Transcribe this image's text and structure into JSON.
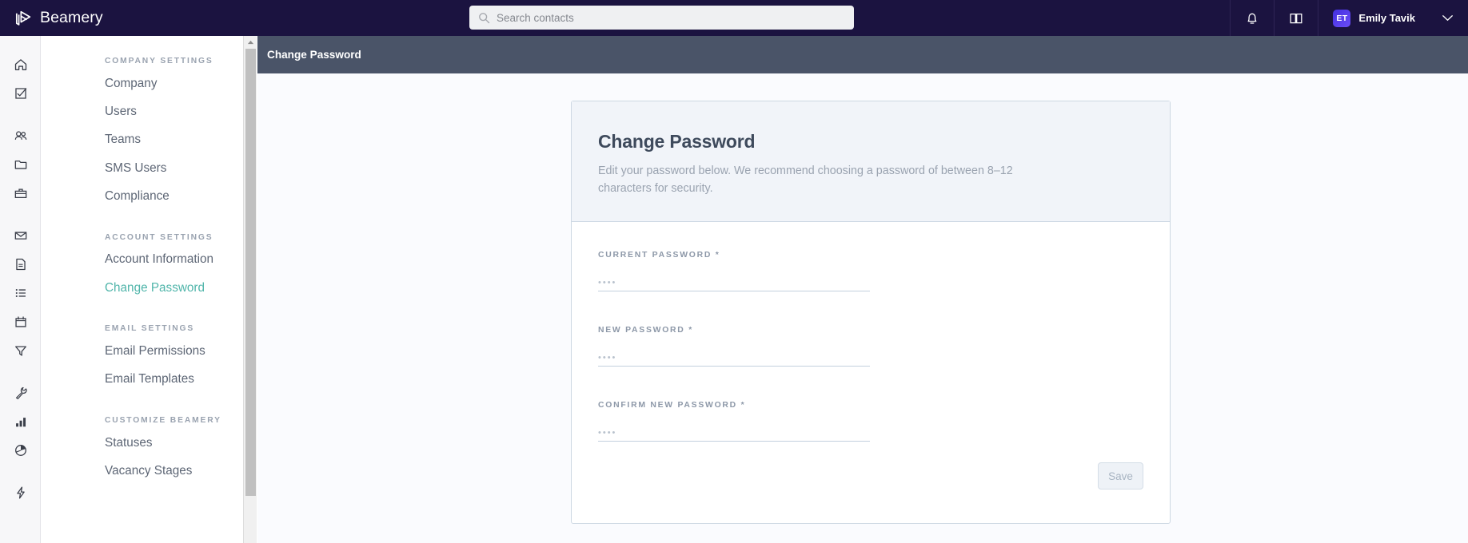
{
  "brand": {
    "name": "Beamery",
    "logo_icon": "beamery-cube-icon"
  },
  "search": {
    "placeholder": "Search contacts",
    "value": "",
    "icon": "search-icon"
  },
  "topbar": {
    "notifications_icon": "bell-icon",
    "knowledge_icon": "book-icon",
    "user_initials": "ET",
    "user_name": "Emily Tavik",
    "caret_icon": "chevron-down-icon",
    "background": "#1b1340"
  },
  "rail": {
    "items": [
      {
        "icon": "home-icon",
        "name": "home"
      },
      {
        "icon": "task-check-icon",
        "name": "tasks"
      },
      {
        "icon": "people-icon",
        "name": "contacts"
      },
      {
        "icon": "folder-icon",
        "name": "pools"
      },
      {
        "icon": "briefcase-icon",
        "name": "vacancies"
      },
      {
        "icon": "envelope-icon",
        "name": "campaigns"
      },
      {
        "icon": "document-icon",
        "name": "pages"
      },
      {
        "icon": "list-icon",
        "name": "lists"
      },
      {
        "icon": "calendar-icon",
        "name": "calendar"
      },
      {
        "icon": "filter-funnel-icon",
        "name": "filters"
      },
      {
        "icon": "wrench-icon",
        "name": "settings"
      },
      {
        "icon": "bar-chart-icon",
        "name": "reports"
      },
      {
        "icon": "pie-chart-icon",
        "name": "analytics"
      },
      {
        "icon": "lightning-bolt-icon",
        "name": "automations"
      }
    ]
  },
  "sidebar": {
    "sections": [
      {
        "heading": "COMPANY SETTINGS",
        "items": [
          {
            "label": "Company",
            "active": false
          },
          {
            "label": "Users",
            "active": false
          },
          {
            "label": "Teams",
            "active": false
          },
          {
            "label": "SMS Users",
            "active": false
          },
          {
            "label": "Compliance",
            "active": false
          }
        ]
      },
      {
        "heading": "ACCOUNT SETTINGS",
        "items": [
          {
            "label": "Account Information",
            "active": false
          },
          {
            "label": "Change Password",
            "active": true
          }
        ]
      },
      {
        "heading": "EMAIL SETTINGS",
        "items": [
          {
            "label": "Email Permissions",
            "active": false
          },
          {
            "label": "Email Templates",
            "active": false
          }
        ]
      },
      {
        "heading": "CUSTOMIZE BEAMERY",
        "items": [
          {
            "label": "Statuses",
            "active": false
          },
          {
            "label": "Vacancy Stages",
            "active": false
          }
        ]
      }
    ],
    "active_color": "#50b5aa"
  },
  "page": {
    "header_title": "Change Password",
    "header_background": "#4a5468"
  },
  "card": {
    "title": "Change Password",
    "description": "Edit your password below. We recommend choosing a password of between 8–12 characters for security.",
    "fields": [
      {
        "label": "CURRENT PASSWORD",
        "required": "*",
        "value": "",
        "placeholder": "••••"
      },
      {
        "label": "NEW PASSWORD",
        "required": "*",
        "value": "",
        "placeholder": "••••"
      },
      {
        "label": "CONFIRM NEW PASSWORD",
        "required": "*",
        "value": "",
        "placeholder": "••••"
      }
    ],
    "save_label": "Save",
    "save_disabled": true
  },
  "scrollbar": {
    "up_arrow_icon": "triangle-up-icon"
  }
}
